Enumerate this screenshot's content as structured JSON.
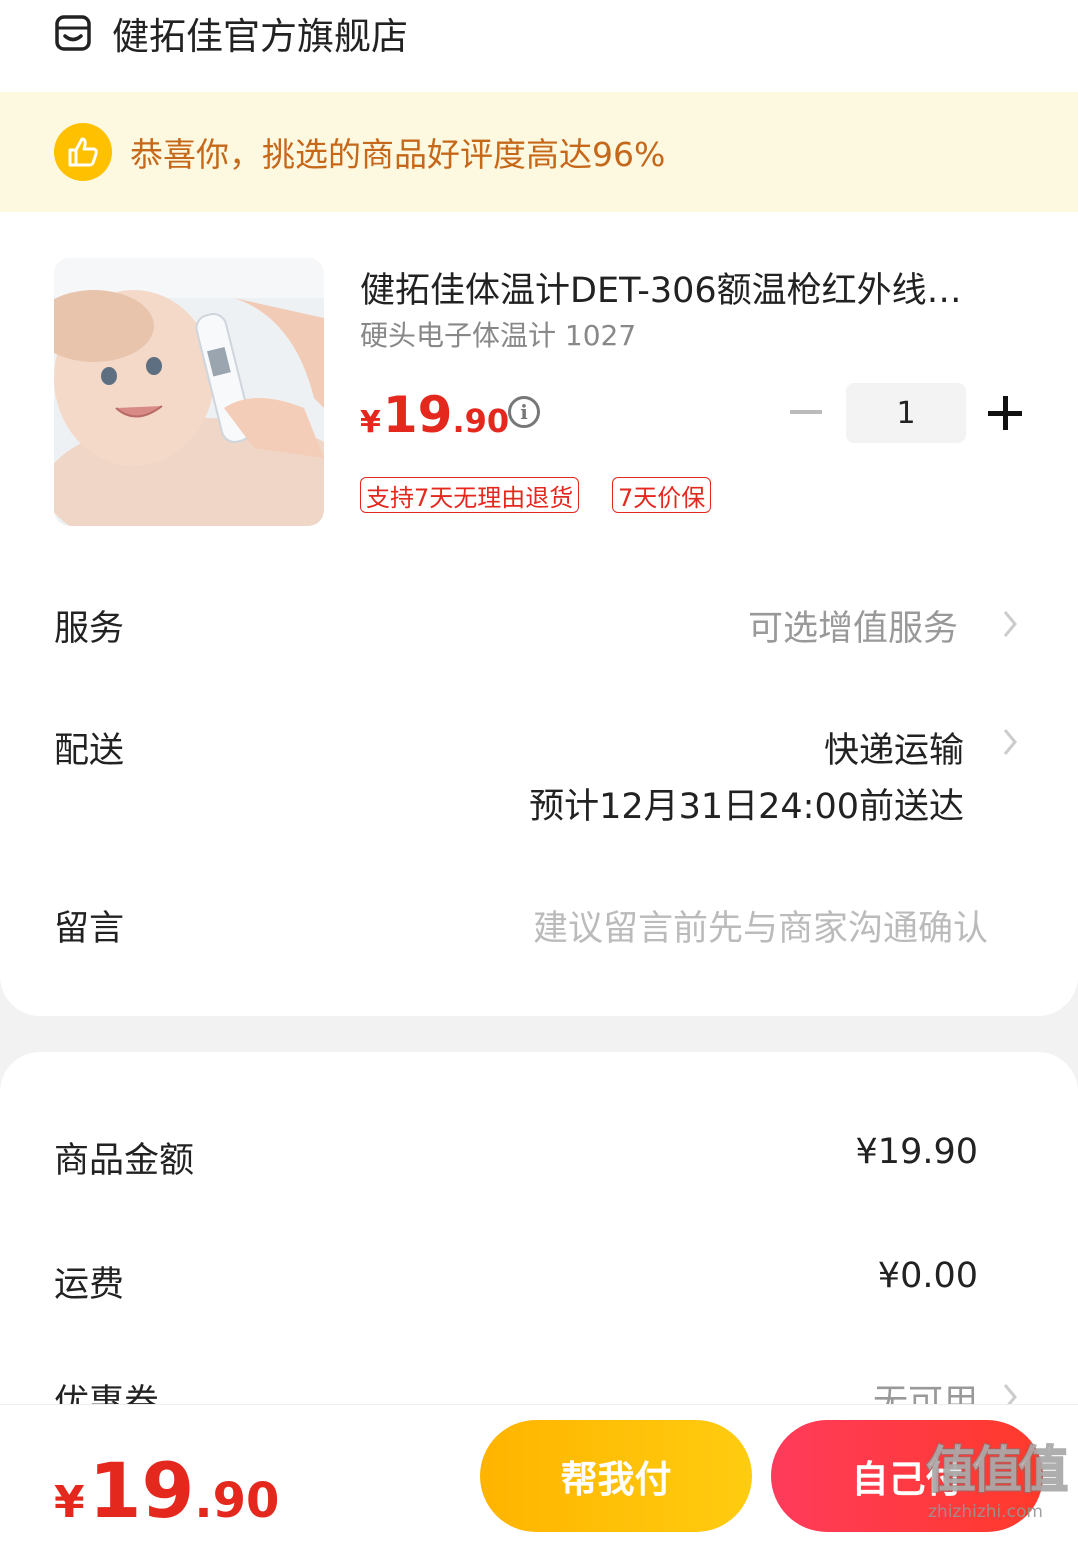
{
  "store": {
    "name": "健拓佳官方旗舰店",
    "icon": "store-icon"
  },
  "banner": {
    "icon": "thumbs-up-icon",
    "text": "恭喜你，挑选的商品好评度高达96%",
    "accent": "#c5681a",
    "background": "#fdf8e0"
  },
  "product": {
    "title": "健拓佳体温计DET-306额温枪红外线…",
    "spec": "硬头电子体温计 1027",
    "price": {
      "currency": "¥",
      "integer": "19",
      "decimal": ".90"
    },
    "quantity": "1",
    "tags": [
      "支持7天无理由退货",
      "7天价保"
    ]
  },
  "rows": {
    "service": {
      "label": "服务",
      "value": "可选增值服务"
    },
    "delivery": {
      "label": "配送",
      "value": "快递运输",
      "eta": "预计12月31日24:00前送达"
    },
    "message": {
      "label": "留言",
      "placeholder": "建议留言前先与商家沟通确认"
    }
  },
  "summary": {
    "goods_amount": {
      "label": "商品金额",
      "value": "¥19.90"
    },
    "shipping": {
      "label": "运费",
      "value": "¥0.00"
    },
    "coupon": {
      "label": "优惠券",
      "value": "无可用"
    }
  },
  "footer": {
    "total": {
      "currency": "¥",
      "integer": "19",
      "decimal": ".90"
    },
    "help_pay_label": "帮我付",
    "self_pay_label": "自己付",
    "price_color": "#e4281e"
  },
  "watermark": {
    "mark": "值值值",
    "url": "zhizhizhi.com"
  }
}
